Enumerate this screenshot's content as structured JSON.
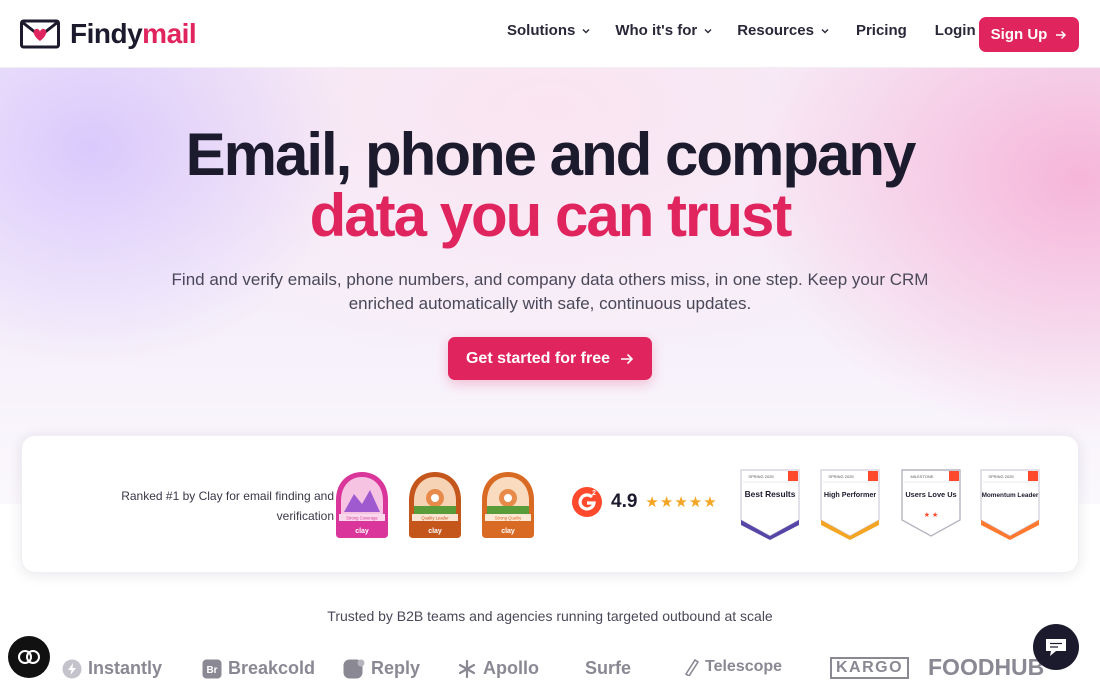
{
  "brand": {
    "name_main": "Findy",
    "name_accent": "mail",
    "icon": "envelope-heart-icon",
    "accent_color": "#e0245e"
  },
  "nav": {
    "items": [
      {
        "label": "Solutions",
        "has_dropdown": true
      },
      {
        "label": "Who it's for",
        "has_dropdown": true
      },
      {
        "label": "Resources",
        "has_dropdown": true
      },
      {
        "label": "Pricing",
        "has_dropdown": false
      },
      {
        "label": "Login",
        "has_dropdown": false
      }
    ],
    "signup_label": "Sign Up"
  },
  "hero": {
    "title_line1": "Email, phone and company",
    "title_line2": "data you can trust",
    "subtitle": "Find and verify emails, phone numbers, and company data others miss, in one step. Keep your CRM enriched automatically with safe, continuous updates.",
    "cta_label": "Get started for free"
  },
  "ranking": {
    "text": "Ranked #1 by Clay for email finding and verification",
    "clay_badges": [
      {
        "label": "Strong Coverage",
        "brand": "clay",
        "color": "#d9359a"
      },
      {
        "label": "Quality Leader",
        "brand": "clay",
        "color": "#c4561c"
      },
      {
        "label": "Strong Quality",
        "brand": "clay",
        "color": "#d86a24"
      }
    ],
    "g2": {
      "logo": "g2-logo-icon",
      "rating": "4.9",
      "stars": "★★★★★"
    },
    "g2_badges": [
      {
        "season": "SPRING 2025",
        "title": "Best Results"
      },
      {
        "season": "SPRING 2025",
        "title": "High Performer"
      },
      {
        "season": "MILESTONE",
        "title": "Users Love Us"
      },
      {
        "season": "SPRING 2025",
        "title": "Momentum Leader"
      }
    ]
  },
  "trusted": {
    "text": "Trusted by B2B teams and agencies running targeted outbound at scale",
    "brands": [
      {
        "name": "Instantly",
        "icon": "bolt-icon"
      },
      {
        "name": "Breakcold",
        "icon": "br-icon"
      },
      {
        "name": "Reply",
        "icon": "bubble-icon"
      },
      {
        "name": "Apollo",
        "icon": "asterisk-icon"
      },
      {
        "name": "Surfe",
        "icon": ""
      },
      {
        "name": "Telescope",
        "icon": "telescope-icon"
      },
      {
        "name": "KARGO",
        "icon": ""
      },
      {
        "name": "FOODHUB",
        "icon": ""
      }
    ]
  }
}
